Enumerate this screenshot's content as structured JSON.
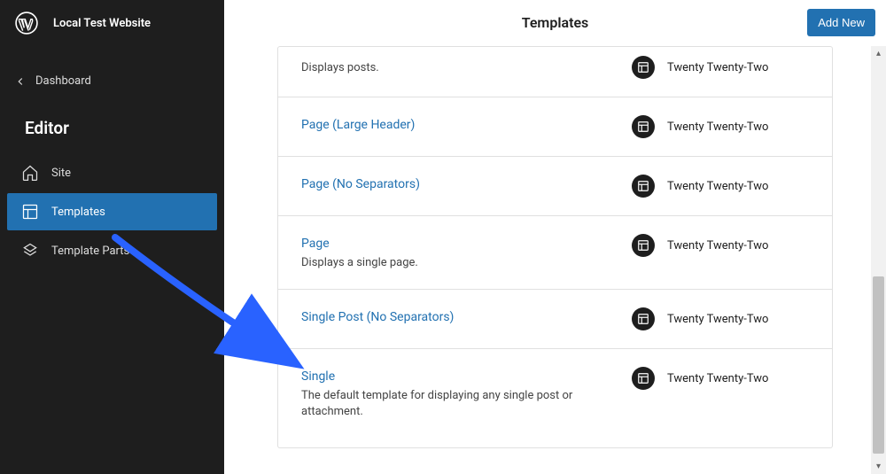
{
  "sidebar": {
    "site_title": "Local Test Website",
    "dashboard_label": "Dashboard",
    "editor_heading": "Editor",
    "nav": [
      {
        "label": "Site",
        "icon": "home-icon",
        "active": false
      },
      {
        "label": "Templates",
        "icon": "layout-icon",
        "active": true
      },
      {
        "label": "Template Parts",
        "icon": "symbol-icon",
        "active": false
      }
    ]
  },
  "header": {
    "title": "Templates",
    "add_new_label": "Add New"
  },
  "templates": [
    {
      "title": "",
      "description": "Displays posts.",
      "theme": "Twenty Twenty-Two"
    },
    {
      "title": "Page (Large Header)",
      "description": "",
      "theme": "Twenty Twenty-Two"
    },
    {
      "title": "Page (No Separators)",
      "description": "",
      "theme": "Twenty Twenty-Two"
    },
    {
      "title": "Page",
      "description": "Displays a single page.",
      "theme": "Twenty Twenty-Two"
    },
    {
      "title": "Single Post (No Separators)",
      "description": "",
      "theme": "Twenty Twenty-Two"
    },
    {
      "title": "Single",
      "description": "The default template for displaying any single post or attachment.",
      "theme": "Twenty Twenty-Two"
    }
  ]
}
